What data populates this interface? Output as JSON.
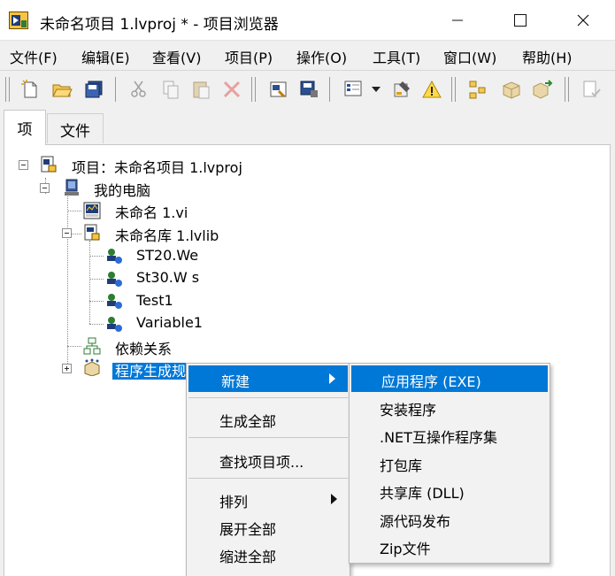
{
  "window": {
    "title": "未命名项目 1.lvproj * - 项目浏览器",
    "minimize_glyph": "—",
    "maximize_glyph": "☐",
    "close_glyph": "✕"
  },
  "menubar": {
    "items": [
      "文件(F)",
      "编辑(E)",
      "查看(V)",
      "项目(P)",
      "操作(O)",
      "工具(T)",
      "窗口(W)",
      "帮助(H)"
    ]
  },
  "tabs": {
    "items": "项",
    "files": "文件"
  },
  "tree": {
    "project": "项目：未命名项目 1.lvproj",
    "my_computer": "我的电脑",
    "vi": "未命名 1.vi",
    "library": "未命名库 1.lvlib",
    "variables": [
      "ST20.We",
      "St30.W s",
      "Test1",
      "Variable1"
    ],
    "dependencies": "依赖关系",
    "build_specs": "程序生成规范"
  },
  "context_menu": {
    "new": "新建",
    "build_all": "生成全部",
    "find_items": "查找项目项...",
    "arrange": "排列",
    "expand_all": "展开全部",
    "collapse_all": "缩进全部"
  },
  "submenu": {
    "items": [
      "应用程序 (EXE)",
      "安装程序",
      ".NET互操作程序集",
      "打包库",
      "共享库 (DLL)",
      "源代码发布",
      "Zip文件"
    ]
  },
  "colors": {
    "selection": "#0078d7",
    "menu_bg": "#f2f2f2",
    "window_bg": "#f0f0f0"
  }
}
